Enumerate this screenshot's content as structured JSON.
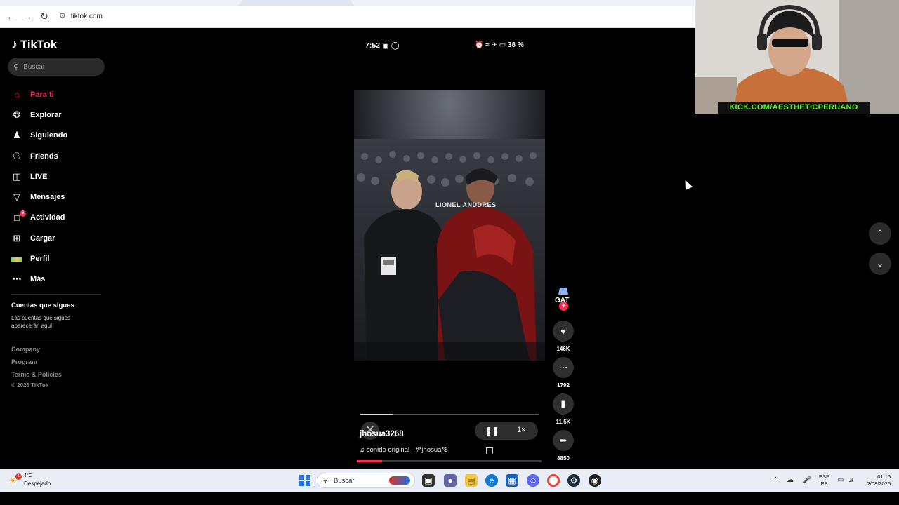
{
  "browser": {
    "url": "tiktok.com"
  },
  "sidebar": {
    "logo_text": "TikTok",
    "search_placeholder": "Buscar",
    "items": [
      {
        "label": "Para ti",
        "icon": "home-icon",
        "active": true
      },
      {
        "label": "Explorar",
        "icon": "compass-icon"
      },
      {
        "label": "Siguiendo",
        "icon": "following-icon"
      },
      {
        "label": "Friends",
        "icon": "friends-icon"
      },
      {
        "label": "LIVE",
        "icon": "live-icon"
      },
      {
        "label": "Mensajes",
        "icon": "messages-icon"
      },
      {
        "label": "Actividad",
        "icon": "activity-icon",
        "badge": "5"
      },
      {
        "label": "Cargar",
        "icon": "upload-icon"
      },
      {
        "label": "Perfil",
        "icon": "profile-icon"
      },
      {
        "label": "Más",
        "icon": "more-icon"
      }
    ],
    "following_title": "Cuentas que sigues",
    "following_subtitle": "Las cuentas que sigues aparecerán aquí",
    "footer": [
      "Company",
      "Program",
      "Terms & Policies",
      "© 2026 TikTok"
    ]
  },
  "phone_status": {
    "time": "7:52",
    "battery": "38 %"
  },
  "video": {
    "watermark": "LIONEL ANDDRES",
    "author": "jhosua3268",
    "sound": "sonido original - #*jhosua*$",
    "speed": "1×",
    "progress_fraction": 0.18
  },
  "actions": {
    "likes": "146K",
    "comments": "1792",
    "saves": "11.5K",
    "shares": "8850"
  },
  "webcam": {
    "banner": "KICK.COM/AESTHETICPERUANO"
  },
  "taskbar": {
    "weather_temp": "4°C",
    "weather_condition": "Despejado",
    "weather_badge": "1",
    "search_placeholder": "Buscar",
    "lang_top": "ESP",
    "lang_bottom": "ES",
    "time": "01:15",
    "date": "2/08/2026"
  },
  "colors": {
    "accent": "#fe2c55",
    "background": "#000000",
    "kick_green": "#53fc18"
  }
}
